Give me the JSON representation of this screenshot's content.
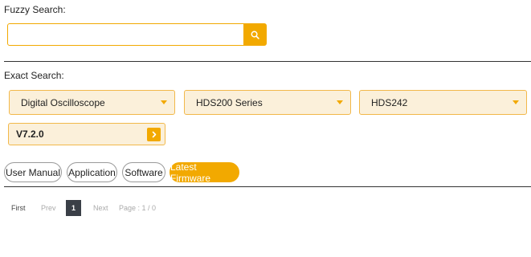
{
  "fuzzy_search": {
    "label": "Fuzzy Search:",
    "value": "",
    "placeholder": "",
    "button_icon": "search-icon"
  },
  "exact_search": {
    "label": "Exact Search:",
    "selects": [
      {
        "value": "Digital Oscilloscope"
      },
      {
        "value": "HDS200 Series"
      },
      {
        "value": "HDS242"
      }
    ],
    "version": {
      "value": "V7.2.0",
      "button_icon": "chevron-right-icon"
    }
  },
  "tabs": [
    {
      "label": "User Manual",
      "active": false
    },
    {
      "label": "Application",
      "active": false
    },
    {
      "label": "Software",
      "active": false
    },
    {
      "label": "Latest Firmware",
      "active": true
    }
  ],
  "pagination": {
    "first": "First",
    "prev": "Prev",
    "current": "1",
    "next": "Next",
    "info": "Page : 1 / 0"
  },
  "colors": {
    "accent": "#f2a900",
    "select_bg": "#fbf0da",
    "active_page_bg": "#3a3f47"
  }
}
